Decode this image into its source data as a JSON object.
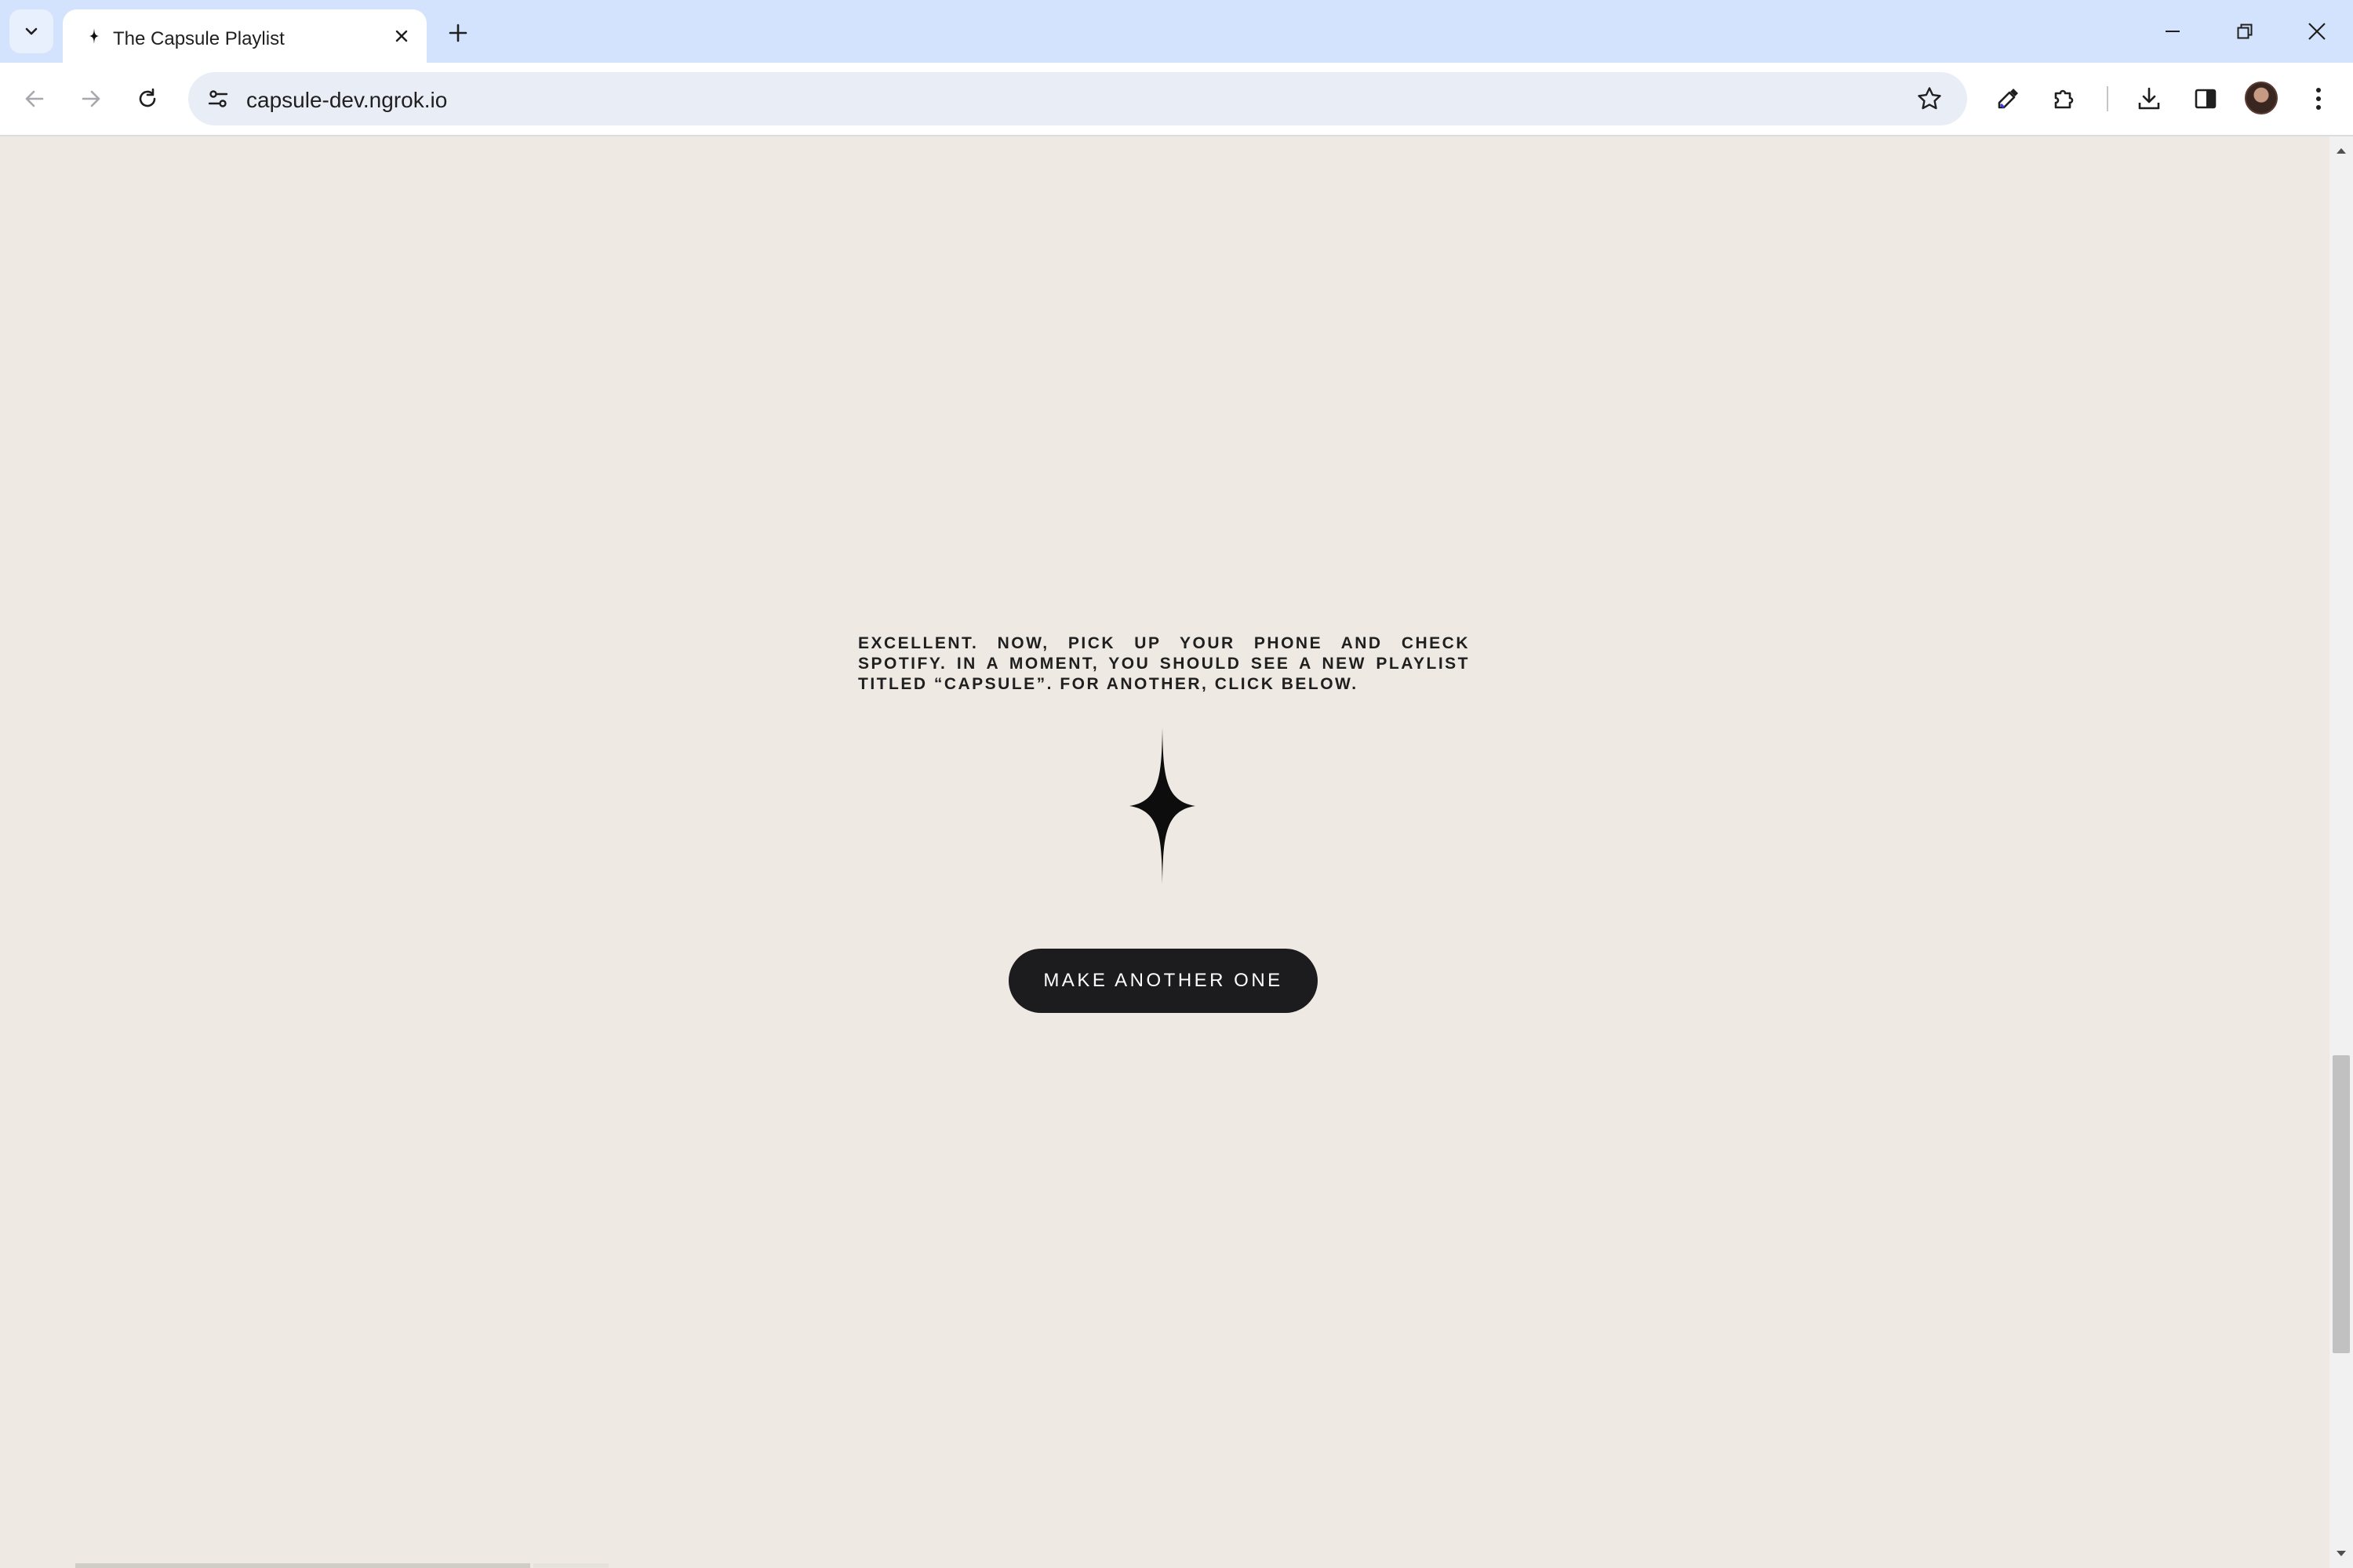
{
  "browser": {
    "tab": {
      "title": "The Capsule Playlist",
      "favicon": "sparkle-icon"
    },
    "address_bar": {
      "url": "capsule-dev.ngrok.io"
    },
    "icons": {
      "tab_search": "chevron-down-icon",
      "close_tab": "close-icon",
      "new_tab": "plus-icon",
      "minimize": "minimize-icon",
      "restore": "restore-icon",
      "close_window": "close-icon",
      "back": "back-arrow-icon",
      "forward": "forward-arrow-icon",
      "reload": "reload-icon",
      "site_info": "tune-icon",
      "bookmark": "star-icon",
      "eyedropper": "eyedropper-icon",
      "extensions": "puzzle-icon",
      "downloads": "download-icon",
      "side_panel": "side-panel-icon",
      "profile": "avatar",
      "menu": "kebab-menu-icon"
    },
    "accent_color": "#d3e3fd"
  },
  "page": {
    "message": "EXCELLENT. NOW, PICK UP YOUR PHONE AND CHECK SPOTIFY. IN A MOMENT, YOU SHOULD SEE A NEW PLAYLIST TITLED “CAPSULE”. FOR ANOTHER, CLICK BELOW.",
    "decoration": "sparkle-icon",
    "cta_label": "MAKE ANOTHER ONE",
    "background_color": "#eee9e3",
    "button_color": "#1c1c1e"
  }
}
